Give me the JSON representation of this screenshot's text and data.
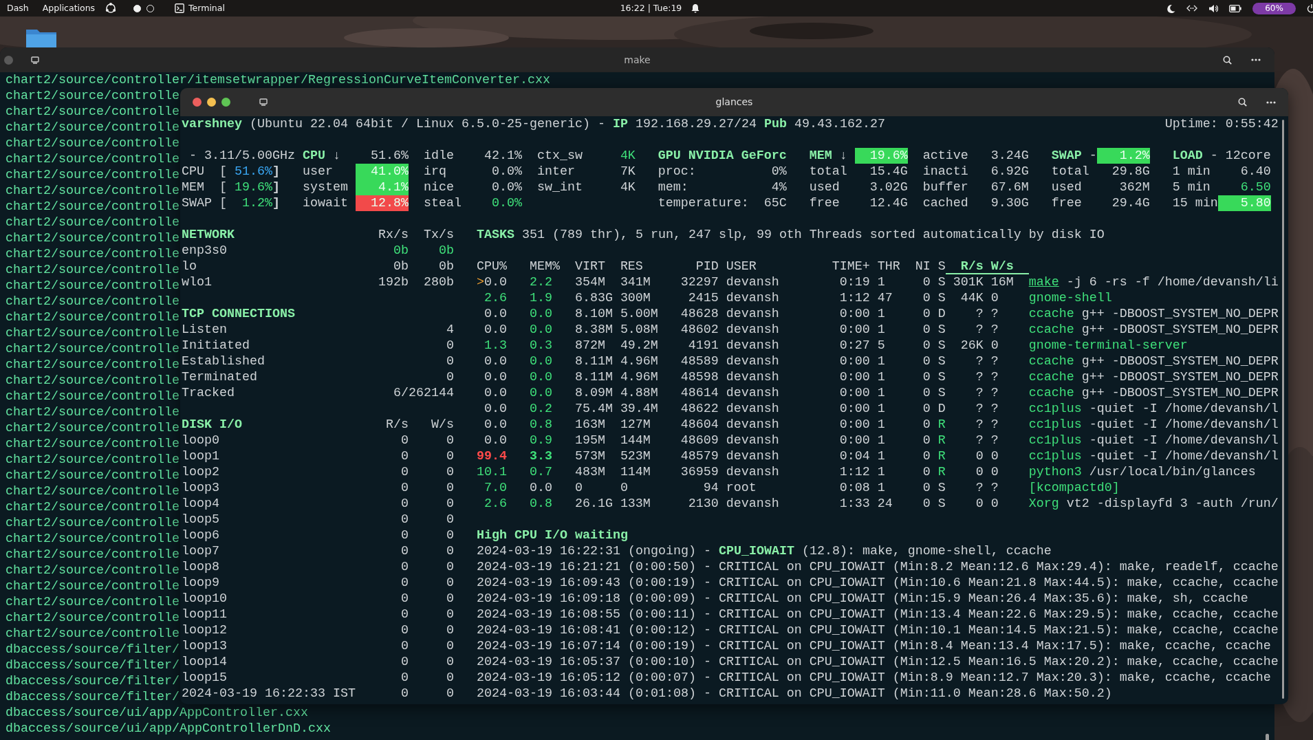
{
  "top_bar": {
    "menus": [
      "Dash",
      "Applications"
    ],
    "workspaces": [
      {
        "selected": true
      },
      {
        "selected": false
      }
    ],
    "app": "Terminal",
    "clock": "16:22 | Tue:19",
    "battery": "60%"
  },
  "make_window": {
    "title": "make",
    "lines": [
      "chart2/source/controller/itemsetwrapper/RegressionCurveItemConverter.cxx",
      "chart2/source/controlle",
      "chart2/source/controlle",
      "chart2/source/controlle",
      "chart2/source/controlle",
      "chart2/source/controlle",
      "chart2/source/controlle",
      "chart2/source/controlle",
      "chart2/source/controlle",
      "chart2/source/controlle",
      "chart2/source/controlle",
      "chart2/source/controlle",
      "chart2/source/controlle",
      "chart2/source/controlle",
      "chart2/source/controlle",
      "chart2/source/controlle",
      "chart2/source/controlle",
      "chart2/source/controlle",
      "chart2/source/controlle",
      "chart2/source/controlle",
      "chart2/source/controlle",
      "chart2/source/controlle",
      "chart2/source/controlle",
      "chart2/source/controlle",
      "chart2/source/controlle",
      "chart2/source/controlle",
      "chart2/source/controlle",
      "chart2/source/controlle",
      "chart2/source/controlle",
      "chart2/source/controlle",
      "chart2/source/controlle",
      "chart2/source/controlle",
      "chart2/source/controlle",
      "chart2/source/controlle",
      "chart2/source/controlle",
      "chart2/source/controlle",
      "dbaccess/source/filter/",
      "dbaccess/source/filter/",
      "dbaccess/source/filter/",
      "dbaccess/source/filter/",
      "dbaccess/source/ui/app/AppController.cxx",
      "dbaccess/source/ui/app/AppControllerDnD.cxx"
    ]
  },
  "glances_window": {
    "title": "glances",
    "system": "**varshney** (Ubuntu 22.04 64bit / Linux 6.5.0-25-generic) - **IP** 192.168.29.27/24 **Pub** 49.43.162.27",
    "uptime": "Uptime: 0:55:42",
    "quicklook": {
      "freq": "- 3.11/5.00GHz",
      "bars": [
        {
          "label": "CPU",
          "open": "[",
          "value": "51.6%",
          "close": "]",
          "color": "#3aa8f5"
        },
        {
          "label": "MEM",
          "open": "[",
          "value": "19.6%",
          "close": "]",
          "color": "#3fe07a"
        },
        {
          "label": "SWAP",
          "open": "[",
          "value": "1.2%",
          "close": "]",
          "color": "#3fe07a"
        }
      ]
    },
    "panels": [
      {
        "kind": "cpu",
        "rows": [
          [
            {
              "kind": "title",
              "text": "CPU",
              "suffix": "↓"
            },
            {
              "kind": "value",
              "text": "51.6%"
            },
            {
              "kind": "label",
              "text": "idle"
            },
            {
              "kind": "value",
              "text": "42.1%"
            },
            {
              "kind": "label",
              "text": "ctx_sw"
            },
            {
              "kind": "value",
              "text": "4K",
              "color": "#3fe07a"
            }
          ],
          [
            {
              "kind": "label",
              "text": "user"
            },
            {
              "kind": "highlight",
              "text": "41.0%",
              "color": "#38d95a"
            },
            {
              "kind": "label",
              "text": "irq"
            },
            {
              "kind": "value",
              "text": "0.0%"
            },
            {
              "kind": "label",
              "text": "inter"
            },
            {
              "kind": "value",
              "text": "7K"
            }
          ],
          [
            {
              "kind": "label",
              "text": "system"
            },
            {
              "kind": "highlight",
              "text": "4.1%",
              "color": "#38d95a"
            },
            {
              "kind": "label",
              "text": "nice"
            },
            {
              "kind": "value",
              "text": "0.0%"
            },
            {
              "kind": "label",
              "text": "sw_int"
            },
            {
              "kind": "value",
              "text": "4K"
            }
          ],
          [
            {
              "kind": "label",
              "text": "iowait"
            },
            {
              "kind": "highlight",
              "text": "12.8%",
              "color": "#f24a4a"
            },
            {
              "kind": "label",
              "text": "steal"
            },
            {
              "kind": "value",
              "text": "0.0%",
              "color": "#3fe07a"
            }
          ]
        ]
      },
      {
        "kind": "gpu",
        "rows": [
          [
            {
              "kind": "title",
              "text": "GPU NVIDIA GeForc"
            }
          ],
          [
            {
              "kind": "label",
              "text": "proc:"
            },
            {
              "kind": "value",
              "text": "0%"
            }
          ],
          [
            {
              "kind": "label",
              "text": "mem:"
            },
            {
              "kind": "value",
              "text": "4%"
            }
          ],
          [
            {
              "kind": "label",
              "text": "temperature:"
            },
            {
              "kind": "value",
              "text": "65C"
            }
          ]
        ]
      },
      {
        "kind": "mem",
        "rows": [
          [
            {
              "kind": "title",
              "text": "MEM",
              "suffix": "↓"
            },
            {
              "kind": "highlight",
              "text": "19.6%",
              "color": "#38d95a"
            },
            {
              "kind": "label",
              "text": "active"
            },
            {
              "kind": "value",
              "text": "3.24G"
            }
          ],
          [
            {
              "kind": "label",
              "text": "total"
            },
            {
              "kind": "value",
              "text": "15.4G"
            },
            {
              "kind": "label",
              "text": "inacti"
            },
            {
              "kind": "value",
              "text": "6.92G"
            }
          ],
          [
            {
              "kind": "label",
              "text": "used"
            },
            {
              "kind": "value",
              "text": "3.02G"
            },
            {
              "kind": "label",
              "text": "buffer"
            },
            {
              "kind": "value",
              "text": "67.6M"
            }
          ],
          [
            {
              "kind": "label",
              "text": "free"
            },
            {
              "kind": "value",
              "text": "12.4G"
            },
            {
              "kind": "label",
              "text": "cached"
            },
            {
              "kind": "value",
              "text": "9.30G"
            }
          ]
        ]
      },
      {
        "kind": "swap",
        "rows": [
          [
            {
              "kind": "title",
              "text": "SWAP",
              "suffix": "-"
            },
            {
              "kind": "highlight",
              "text": "1.2%",
              "color": "#38d95a"
            }
          ],
          [
            {
              "kind": "label",
              "text": "total"
            },
            {
              "kind": "value",
              "text": "29.8G"
            }
          ],
          [
            {
              "kind": "label",
              "text": "used"
            },
            {
              "kind": "value",
              "text": "362M"
            }
          ],
          [
            {
              "kind": "label",
              "text": "free"
            },
            {
              "kind": "value",
              "text": "29.4G"
            }
          ]
        ]
      },
      {
        "kind": "load",
        "rows": [
          [
            {
              "kind": "title",
              "text": "LOAD",
              "suffix": "-"
            },
            {
              "kind": "value",
              "text": "12core"
            }
          ],
          [
            {
              "kind": "label",
              "text": "1 min"
            },
            {
              "kind": "value",
              "text": "6.40"
            }
          ],
          [
            {
              "kind": "label",
              "text": "5 min"
            },
            {
              "kind": "value",
              "text": "6.50",
              "color": "#3fe07a"
            }
          ],
          [
            {
              "kind": "label",
              "text": "15 min"
            },
            {
              "kind": "highlight",
              "text": "5.80",
              "color": "#38d95a"
            }
          ]
        ]
      }
    ],
    "network": {
      "title": "NETWORK",
      "columns": [
        "Rx/s",
        "Tx/s"
      ],
      "rows": [
        {
          "name": "enp3s0",
          "rx": "0b",
          "tx": "0b",
          "color": "#3fe07a"
        },
        {
          "name": "lo",
          "rx": "0b",
          "tx": "0b",
          "color": "#cfd3d6"
        },
        {
          "name": "wlo1",
          "rx": "192b",
          "tx": "280b",
          "color": "#cfd3d6"
        }
      ]
    },
    "tcp": {
      "title": "TCP CONNECTIONS",
      "rows": [
        {
          "label": "Listen",
          "value": "4"
        },
        {
          "label": "Initiated",
          "value": "0"
        },
        {
          "label": "Established",
          "value": "0"
        },
        {
          "label": "Terminated",
          "value": "0"
        },
        {
          "label": "Tracked",
          "value": "6/262144"
        }
      ]
    },
    "disk": {
      "title": "DISK I/O",
      "columns": [
        "R/s",
        "W/s"
      ],
      "rows": [
        {
          "name": "loop0",
          "read": "0",
          "write": "0"
        },
        {
          "name": "loop1",
          "read": "0",
          "write": "0"
        },
        {
          "name": "loop2",
          "read": "0",
          "write": "0"
        },
        {
          "name": "loop3",
          "read": "0",
          "write": "0"
        },
        {
          "name": "loop4",
          "read": "0",
          "write": "0"
        },
        {
          "name": "loop5",
          "read": "0",
          "write": "0"
        },
        {
          "name": "loop6",
          "read": "0",
          "write": "0"
        },
        {
          "name": "loop7",
          "read": "0",
          "write": "0"
        },
        {
          "name": "loop8",
          "read": "0",
          "write": "0"
        },
        {
          "name": "loop9",
          "read": "0",
          "write": "0"
        },
        {
          "name": "loop10",
          "read": "0",
          "write": "0"
        },
        {
          "name": "loop11",
          "read": "0",
          "write": "0"
        },
        {
          "name": "loop12",
          "read": "0",
          "write": "0"
        },
        {
          "name": "loop13",
          "read": "0",
          "write": "0"
        },
        {
          "name": "loop14",
          "read": "0",
          "write": "0"
        },
        {
          "name": "loop15",
          "read": "0",
          "write": "0"
        }
      ],
      "clock": {
        "datetime": "2024-03-19 16:22:33 IST",
        "read": "0",
        "write": "0"
      }
    },
    "tasks": "**TASKS** 351 (789 thr), 5 run, 247 slp, 99 oth Threads sorted automatically by disk IO",
    "processes": {
      "cursor": ">",
      "columns": [
        {
          "label": "CPU%",
          "sorted": false
        },
        {
          "label": "MEM%",
          "sorted": false
        },
        {
          "label": "VIRT",
          "sorted": false
        },
        {
          "label": "RES",
          "sorted": false
        },
        {
          "label": "PID",
          "sorted": false
        },
        {
          "label": "USER",
          "sorted": false
        },
        {
          "label": "TIME+",
          "sorted": false
        },
        {
          "label": "THR",
          "sorted": false
        },
        {
          "label": "NI",
          "sorted": false
        },
        {
          "label": "S",
          "sorted": false
        },
        {
          "label": "R/s",
          "sorted": true
        },
        {
          "label": "W/s",
          "sorted": true
        }
      ],
      "rows": [
        {
          "selected": true,
          "cpu": {
            "text": "0.0",
            "color": "#cfd3d6"
          },
          "mem": {
            "text": "2.2",
            "color": "#3fe07a"
          },
          "virt": "354M",
          "res": "341M",
          "pid": "32297",
          "user": "devansh",
          "time": "0:19",
          "thr": "1",
          "ni": "0",
          "state": {
            "text": "S",
            "color": "#cfd3d6"
          },
          "rs": "301K",
          "ws": "16M",
          "name": "make",
          "args": "-j 6 -rs -f /home/devansh/li"
        },
        {
          "selected": false,
          "cpu": {
            "text": "2.6",
            "color": "#3fe07a"
          },
          "mem": {
            "text": "1.9",
            "color": "#3fe07a"
          },
          "virt": "6.83G",
          "res": "300M",
          "pid": "2415",
          "user": "devansh",
          "time": "1:12",
          "thr": "47",
          "ni": "0",
          "state": {
            "text": "S",
            "color": "#cfd3d6"
          },
          "rs": "44K",
          "ws": "0",
          "name": "gnome-shell"
        },
        {
          "selected": false,
          "cpu": {
            "text": "0.0",
            "color": "#cfd3d6"
          },
          "mem": {
            "text": "0.0",
            "color": "#3fe07a"
          },
          "virt": "8.10M",
          "res": "5.00M",
          "pid": "48628",
          "user": "devansh",
          "time": "0:00",
          "thr": "1",
          "ni": "0",
          "state": {
            "text": "D",
            "color": "#cfd3d6"
          },
          "rs": "?",
          "ws": "?",
          "name": "ccache",
          "args": "g++ -DBOOST_SYSTEM_NO_DEPR"
        },
        {
          "selected": false,
          "cpu": {
            "text": "0.0",
            "color": "#cfd3d6"
          },
          "mem": {
            "text": "0.0",
            "color": "#3fe07a"
          },
          "virt": "8.38M",
          "res": "5.08M",
          "pid": "48602",
          "user": "devansh",
          "time": "0:00",
          "thr": "1",
          "ni": "0",
          "state": {
            "text": "S",
            "color": "#cfd3d6"
          },
          "rs": "?",
          "ws": "?",
          "name": "ccache",
          "args": "g++ -DBOOST_SYSTEM_NO_DEPR"
        },
        {
          "selected": false,
          "cpu": {
            "text": "1.3",
            "color": "#3fe07a"
          },
          "mem": {
            "text": "0.3",
            "color": "#3fe07a"
          },
          "virt": "872M",
          "res": "49.2M",
          "pid": "4191",
          "user": "devansh",
          "time": "0:27",
          "thr": "5",
          "ni": "0",
          "state": {
            "text": "S",
            "color": "#cfd3d6"
          },
          "rs": "26K",
          "ws": "0",
          "name": "gnome-terminal-server"
        },
        {
          "selected": false,
          "cpu": {
            "text": "0.0",
            "color": "#cfd3d6"
          },
          "mem": {
            "text": "0.0",
            "color": "#3fe07a"
          },
          "virt": "8.11M",
          "res": "4.96M",
          "pid": "48589",
          "user": "devansh",
          "time": "0:00",
          "thr": "1",
          "ni": "0",
          "state": {
            "text": "S",
            "color": "#cfd3d6"
          },
          "rs": "?",
          "ws": "?",
          "name": "ccache",
          "args": "g++ -DBOOST_SYSTEM_NO_DEPR"
        },
        {
          "selected": false,
          "cpu": {
            "text": "0.0",
            "color": "#cfd3d6"
          },
          "mem": {
            "text": "0.0",
            "color": "#3fe07a"
          },
          "virt": "8.11M",
          "res": "4.96M",
          "pid": "48598",
          "user": "devansh",
          "time": "0:00",
          "thr": "1",
          "ni": "0",
          "state": {
            "text": "S",
            "color": "#cfd3d6"
          },
          "rs": "?",
          "ws": "?",
          "name": "ccache",
          "args": "g++ -DBOOST_SYSTEM_NO_DEPR"
        },
        {
          "selected": false,
          "cpu": {
            "text": "0.0",
            "color": "#cfd3d6"
          },
          "mem": {
            "text": "0.0",
            "color": "#3fe07a"
          },
          "virt": "8.09M",
          "res": "4.88M",
          "pid": "48614",
          "user": "devansh",
          "time": "0:00",
          "thr": "1",
          "ni": "0",
          "state": {
            "text": "S",
            "color": "#cfd3d6"
          },
          "rs": "?",
          "ws": "?",
          "name": "ccache",
          "args": "g++ -DBOOST_SYSTEM_NO_DEPR"
        },
        {
          "selected": false,
          "cpu": {
            "text": "0.0",
            "color": "#cfd3d6"
          },
          "mem": {
            "text": "0.2",
            "color": "#3fe07a"
          },
          "virt": "75.4M",
          "res": "39.4M",
          "pid": "48622",
          "user": "devansh",
          "time": "0:00",
          "thr": "1",
          "ni": "0",
          "state": {
            "text": "D",
            "color": "#cfd3d6"
          },
          "rs": "?",
          "ws": "?",
          "name": "cc1plus",
          "args": "-quiet -I /home/devansh/l"
        },
        {
          "selected": false,
          "cpu": {
            "text": "0.0",
            "color": "#cfd3d6"
          },
          "mem": {
            "text": "0.8",
            "color": "#3fe07a"
          },
          "virt": "163M",
          "res": "127M",
          "pid": "48604",
          "user": "devansh",
          "time": "0:00",
          "thr": "1",
          "ni": "0",
          "state": {
            "text": "R",
            "color": "#3fe07a"
          },
          "rs": "?",
          "ws": "?",
          "name": "cc1plus",
          "args": "-quiet -I /home/devansh/l"
        },
        {
          "selected": false,
          "cpu": {
            "text": "0.0",
            "color": "#cfd3d6"
          },
          "mem": {
            "text": "0.9",
            "color": "#3fe07a"
          },
          "virt": "195M",
          "res": "144M",
          "pid": "48609",
          "user": "devansh",
          "time": "0:00",
          "thr": "1",
          "ni": "0",
          "state": {
            "text": "R",
            "color": "#3fe07a"
          },
          "rs": "?",
          "ws": "?",
          "name": "cc1plus",
          "args": "-quiet -I /home/devansh/l"
        },
        {
          "selected": false,
          "cpu": {
            "text": "99.4",
            "color": "#ff4a4a",
            "bold": true
          },
          "mem": {
            "text": "3.3",
            "color": "#3fe07a",
            "bold": true
          },
          "virt": "573M",
          "res": "523M",
          "pid": "48579",
          "user": "devansh",
          "time": "0:04",
          "thr": "1",
          "ni": "0",
          "state": {
            "text": "R",
            "color": "#3fe07a"
          },
          "rs": "0",
          "ws": "0",
          "name": "cc1plus",
          "args": "-quiet -I /home/devansh/l"
        },
        {
          "selected": false,
          "cpu": {
            "text": "10.1",
            "color": "#3fe07a"
          },
          "mem": {
            "text": "0.7",
            "color": "#3fe07a"
          },
          "virt": "483M",
          "res": "114M",
          "pid": "36959",
          "user": "devansh",
          "time": "1:12",
          "thr": "1",
          "ni": "0",
          "state": {
            "text": "R",
            "color": "#3fe07a"
          },
          "rs": "0",
          "ws": "0",
          "name": "python3",
          "args": "/usr/local/bin/glances"
        },
        {
          "selected": false,
          "cpu": {
            "text": "7.0",
            "color": "#3fe07a"
          },
          "mem": {
            "text": "0.0",
            "color": "#cfd3d6"
          },
          "virt": "0",
          "res": "0",
          "pid": "94",
          "user": "root",
          "time": "0:08",
          "thr": "1",
          "ni": "0",
          "state": {
            "text": "S",
            "color": "#cfd3d6"
          },
          "rs": "?",
          "ws": "?",
          "name": "[kcompactd0]"
        },
        {
          "selected": false,
          "cpu": {
            "text": "2.6",
            "color": "#3fe07a"
          },
          "mem": {
            "text": "0.8",
            "color": "#3fe07a"
          },
          "virt": "26.1G",
          "res": "133M",
          "pid": "2130",
          "user": "devansh",
          "time": "1:33",
          "thr": "24",
          "ni": "0",
          "state": {
            "text": "S",
            "color": "#cfd3d6"
          },
          "rs": "0",
          "ws": "0",
          "name": "Xorg",
          "args": "vt2 -displayfd 3 -auth /run/"
        }
      ]
    },
    "events": {
      "title": "High CPU I/O waiting",
      "entries": [
        "2024-03-19 16:22:31 (ongoing) - **CPU_IOWAIT** (12.8): make, gnome-shell, ccache",
        "2024-03-19 16:21:21 (0:00:50) - CRITICAL on CPU_IOWAIT (Min:8.2 Mean:12.6 Max:29.4): make, readelf, ccache",
        "2024-03-19 16:09:43 (0:00:19) - CRITICAL on CPU_IOWAIT (Min:10.6 Mean:21.8 Max:44.5): make, ccache, ccache",
        "2024-03-19 16:09:18 (0:00:09) - CRITICAL on CPU_IOWAIT (Min:15.9 Mean:26.4 Max:35.6): make, sh, ccache",
        "2024-03-19 16:08:55 (0:00:11) - CRITICAL on CPU_IOWAIT (Min:13.4 Mean:22.6 Max:29.5): make, ccache, ccache",
        "2024-03-19 16:08:41 (0:00:12) - CRITICAL on CPU_IOWAIT (Min:10.1 Mean:14.5 Max:21.5): make, ccache, ccache",
        "2024-03-19 16:07:14 (0:00:19) - CRITICAL on CPU_IOWAIT (Min:8.4 Mean:13.4 Max:17.5): make, ccache, ccache",
        "2024-03-19 16:05:37 (0:00:10) - CRITICAL on CPU_IOWAIT (Min:12.5 Mean:16.5 Max:20.2): make, ccache, ccache",
        "2024-03-19 16:05:12 (0:00:07) - CRITICAL on CPU_IOWAIT (Min:8.9 Mean:12.7 Max:20.3): make, ccache, ccache",
        "2024-03-19 16:03:44 (0:01:08) - CRITICAL on CPU_IOWAIT (Min:11.0 Mean:28.6 Max:50.2)"
      ]
    }
  }
}
